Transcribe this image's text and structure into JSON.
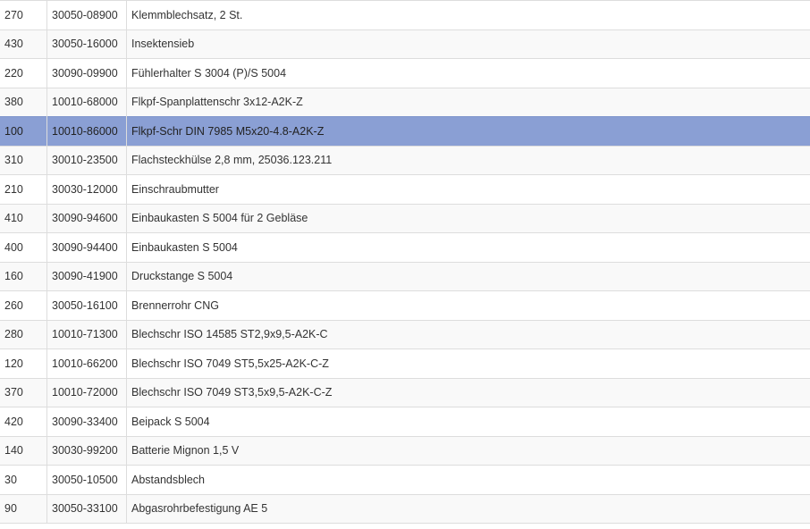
{
  "selected_index": 4,
  "rows": [
    {
      "pos": "270",
      "article": "30050-08900",
      "description": "Klemmblechsatz, 2 St."
    },
    {
      "pos": "430",
      "article": "30050-16000",
      "description": "Insektensieb"
    },
    {
      "pos": "220",
      "article": "30090-09900",
      "description": "Fühlerhalter S 3004 (P)/S 5004"
    },
    {
      "pos": "380",
      "article": "10010-68000",
      "description": "Flkpf-Spanplattenschr 3x12-A2K-Z"
    },
    {
      "pos": "100",
      "article": "10010-86000",
      "description": "Flkpf-Schr DIN 7985 M5x20-4.8-A2K-Z"
    },
    {
      "pos": "310",
      "article": "30010-23500",
      "description": "Flachsteckhülse 2,8 mm, 25036.123.211"
    },
    {
      "pos": "210",
      "article": "30030-12000",
      "description": "Einschraubmutter"
    },
    {
      "pos": "410",
      "article": "30090-94600",
      "description": "Einbaukasten S 5004 für 2 Gebläse"
    },
    {
      "pos": "400",
      "article": "30090-94400",
      "description": "Einbaukasten S 5004"
    },
    {
      "pos": "160",
      "article": "30090-41900",
      "description": "Druckstange S 5004"
    },
    {
      "pos": "260",
      "article": "30050-16100",
      "description": "Brennerrohr CNG"
    },
    {
      "pos": "280",
      "article": "10010-71300",
      "description": "Blechschr ISO 14585 ST2,9x9,5-A2K-C"
    },
    {
      "pos": "120",
      "article": "10010-66200",
      "description": "Blechschr ISO 7049 ST5,5x25-A2K-C-Z"
    },
    {
      "pos": "370",
      "article": "10010-72000",
      "description": "Blechschr ISO 7049 ST3,5x9,5-A2K-C-Z"
    },
    {
      "pos": "420",
      "article": "30090-33400",
      "description": "Beipack S 5004"
    },
    {
      "pos": "140",
      "article": "30030-99200",
      "description": "Batterie Mignon 1,5 V"
    },
    {
      "pos": "30",
      "article": "30050-10500",
      "description": "Abstandsblech"
    },
    {
      "pos": "90",
      "article": "30050-33100",
      "description": "Abgasrohrbefestigung AE 5"
    }
  ],
  "colors": {
    "selected_row": "#8a9fd4",
    "stripe": "#f9f9f9",
    "border": "#dddddd"
  }
}
